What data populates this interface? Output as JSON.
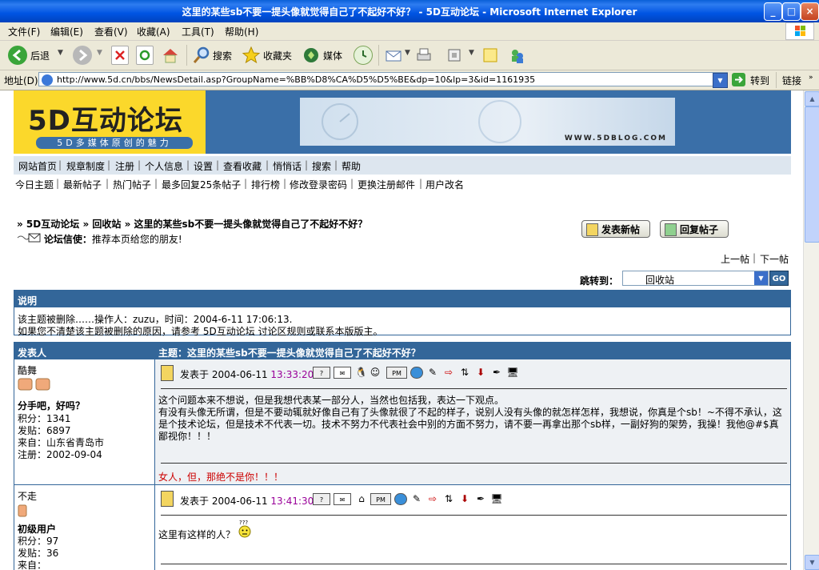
{
  "window": {
    "title": "这里的某些sb不要一提头像就觉得自己了不起好不好？ - 5D互动论坛 - Microsoft Internet Explorer"
  },
  "menu": [
    "文件(F)",
    "编辑(E)",
    "查看(V)",
    "收藏(A)",
    "工具(T)",
    "帮助(H)"
  ],
  "toolbar": {
    "back": "后退",
    "search": "搜索",
    "favorites": "收藏夹",
    "media": "媒体"
  },
  "address": {
    "label": "地址(D)",
    "url": "http://www.5d.cn/bbs/NewsDetail.asp?GroupName=%BB%D8%CA%D5%D5%BE&dp=10&lp=3&id=1161935",
    "go": "转到",
    "links": "链接"
  },
  "site": {
    "logo": "5D互动论坛",
    "slogan": "5D多媒体原创的魅力",
    "ad_domain": "WWW.5DBLOG.COM"
  },
  "nav_primary": [
    "网站首页",
    "规章制度",
    "注册",
    "个人信息",
    "设置",
    "查看收藏",
    "悄悄话",
    "搜索",
    "帮助"
  ],
  "nav_secondary": [
    "今日主题",
    "最新帖子",
    "热门帖子",
    "最多回复25条帖子",
    "排行榜",
    "修改登录密码",
    "更换注册邮件",
    "用户改名"
  ],
  "breadcrumb": {
    "forum": "» 5D互动论坛",
    "board": "» 回收站",
    "topic": "» 这里的某些sb不要一提头像就觉得自己了不起好不好？"
  },
  "messenger": {
    "label": "论坛信使：",
    "text": "推荐本页给您的朋友!"
  },
  "buttons": {
    "new_post": "发表新帖",
    "reply": "回复帖子",
    "prev": "上一帖",
    "next": "下一帖",
    "jump_label": "跳转到：",
    "jump_value": "回收站",
    "go": "GO"
  },
  "notice": {
    "header": "说明",
    "line1": "该主题被删除……操作人：zuzu，时间：2004-6-11 17:06:13.",
    "line2": "如果您不清楚该主题被删除的原因，请参考 5D互动论坛 讨论区规则或联系本版版主。"
  },
  "thread": {
    "author_header": "发表人",
    "topic_header": "主题：这里的某些sb不要一提头像就觉得自己了不起好不好？"
  },
  "posts": [
    {
      "author": "酷舞",
      "title": "分手吧，好吗？",
      "points": "积分：1341",
      "posts": "发贴：6897",
      "from": "来自：山东省青岛市",
      "registered": "注册：2002-09-04",
      "posted_label": "发表于",
      "date": "2004-06-11",
      "time": "13:33:20",
      "body": "这个问题本来不想说，但是我想代表某一部分人，当然也包括我，表达一下观点。\n有没有头像无所谓，但是不要动辄就好像自己有了头像就很了不起的样子，说别人没有头像的就怎样怎样，我想说，你真是个sb！~不得不承认，这是个技术论坛，但是技术不代表一切。技术不努力不代表社会中别的方面不努力，请不要一再拿出那个sb样，一副好狗的架势，我操！我他@#$真鄙视你！！！",
      "signature": "女人，但，那绝不是你！！！"
    },
    {
      "author": "不走",
      "title": "初级用户",
      "points": "积分：97",
      "posts": "发贴：36",
      "from": "来自：",
      "posted_label": "发表于",
      "date": "2004-06-11",
      "time": "13:41:30",
      "body": "这里有这样的人？"
    }
  ],
  "colors": {
    "header_blue": "#336699",
    "time_purple": "#990099",
    "signature_red": "#cc0000"
  }
}
